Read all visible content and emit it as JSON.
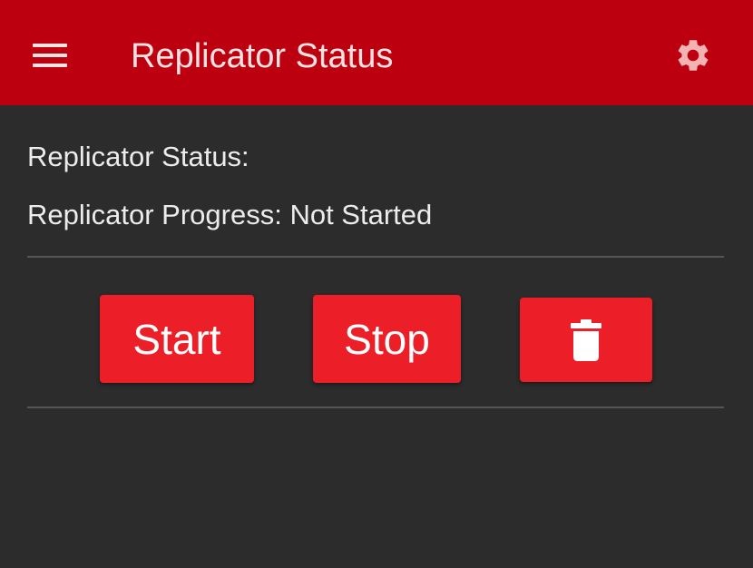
{
  "app_bar": {
    "title": "Replicator Status",
    "menu_icon": "hamburger-menu-icon",
    "settings_icon": "gear-icon",
    "background_color": "#bc0010"
  },
  "status": {
    "status_line": "Replicator Status:",
    "progress_line": "Replicator Progress: Not Started"
  },
  "actions": {
    "start_label": "Start",
    "stop_label": "Stop",
    "delete_icon": "trash-icon",
    "button_color": "#ec1f28"
  }
}
